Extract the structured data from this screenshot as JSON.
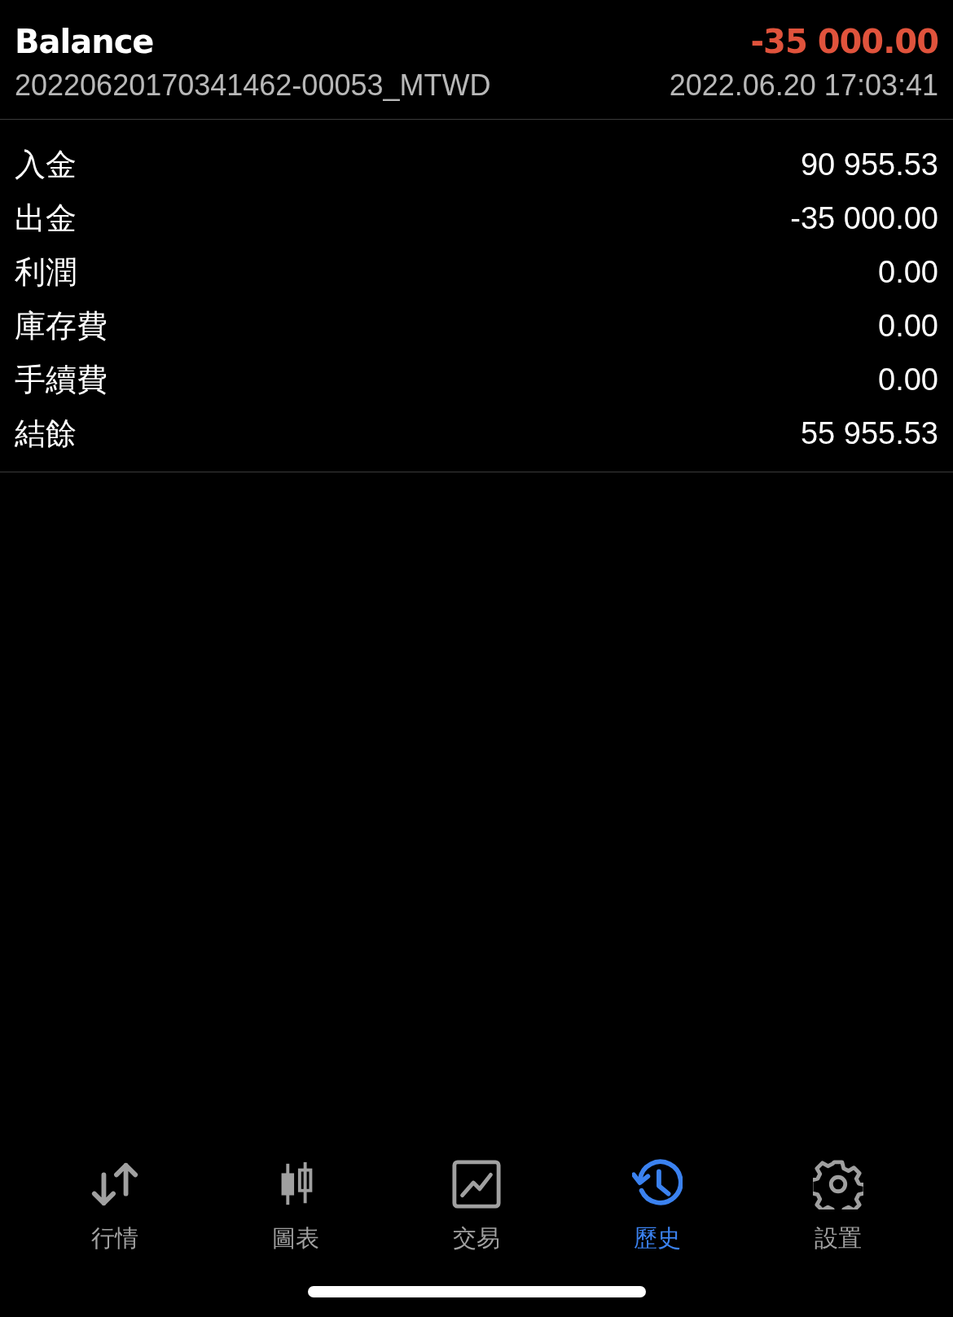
{
  "header": {
    "title": "Balance",
    "amount": "-35 000.00",
    "deal_id": "20220620170341462-00053_MTWD",
    "time": "2022.06.20 17:03:41"
  },
  "summary": [
    {
      "label": "入金",
      "value": "90 955.53"
    },
    {
      "label": "出金",
      "value": "-35 000.00"
    },
    {
      "label": "利潤",
      "value": "0.00"
    },
    {
      "label": "庫存費",
      "value": "0.00"
    },
    {
      "label": "手續費",
      "value": "0.00"
    },
    {
      "label": "結餘",
      "value": "55 955.53"
    }
  ],
  "tabs": [
    {
      "label": "行情",
      "kind": "quotes",
      "selected": false
    },
    {
      "label": "圖表",
      "kind": "chart",
      "selected": false
    },
    {
      "label": "交易",
      "kind": "trade",
      "selected": false
    },
    {
      "label": "歷史",
      "kind": "history",
      "selected": true
    },
    {
      "label": "設置",
      "kind": "settings",
      "selected": false
    }
  ]
}
